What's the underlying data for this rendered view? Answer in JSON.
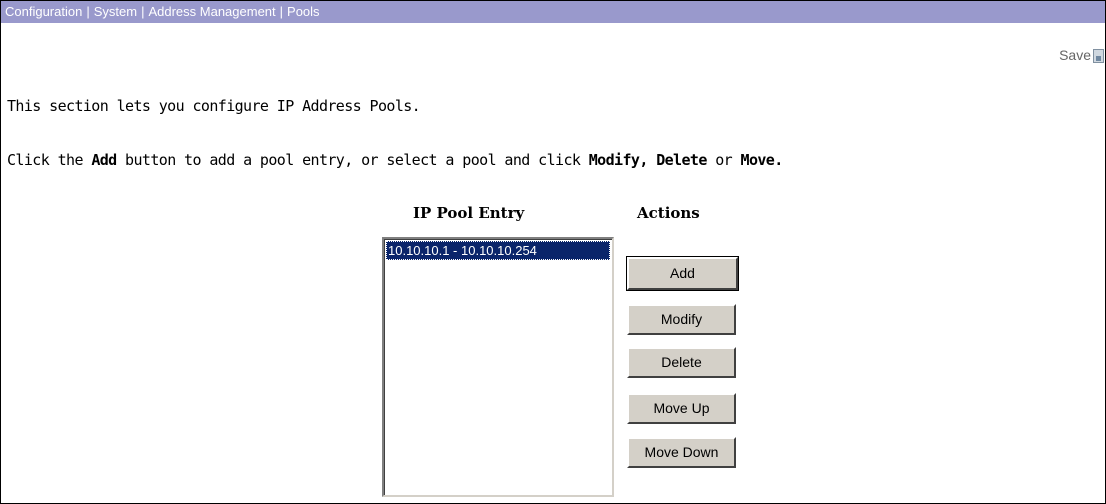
{
  "breadcrumb": {
    "items": [
      "Configuration",
      "System",
      "Address Management",
      "Pools"
    ],
    "separator": "|"
  },
  "save": {
    "label": "Save",
    "icon": "save-icon"
  },
  "intro_text": "This section lets you configure IP Address Pools.",
  "instructions": {
    "part1": "Click the ",
    "add_word": "Add",
    "part2": " button to add a pool entry, or select a pool and click ",
    "modify_word": "Modify,",
    "part3": " ",
    "delete_word": "Delete",
    "part4": " or ",
    "move_word": "Move."
  },
  "pool_list": {
    "header": "IP Pool Entry",
    "entries": [
      "10.10.10.1 - 10.10.10.254"
    ],
    "selected_index": 0
  },
  "actions": {
    "header": "Actions",
    "add": "Add",
    "modify": "Modify",
    "delete": "Delete",
    "move_up": "Move Up",
    "move_down": "Move Down"
  },
  "colors": {
    "breadcrumb_bg": "#9999cc",
    "selection_bg": "#0a246a",
    "button_face": "#d4d0c8"
  }
}
